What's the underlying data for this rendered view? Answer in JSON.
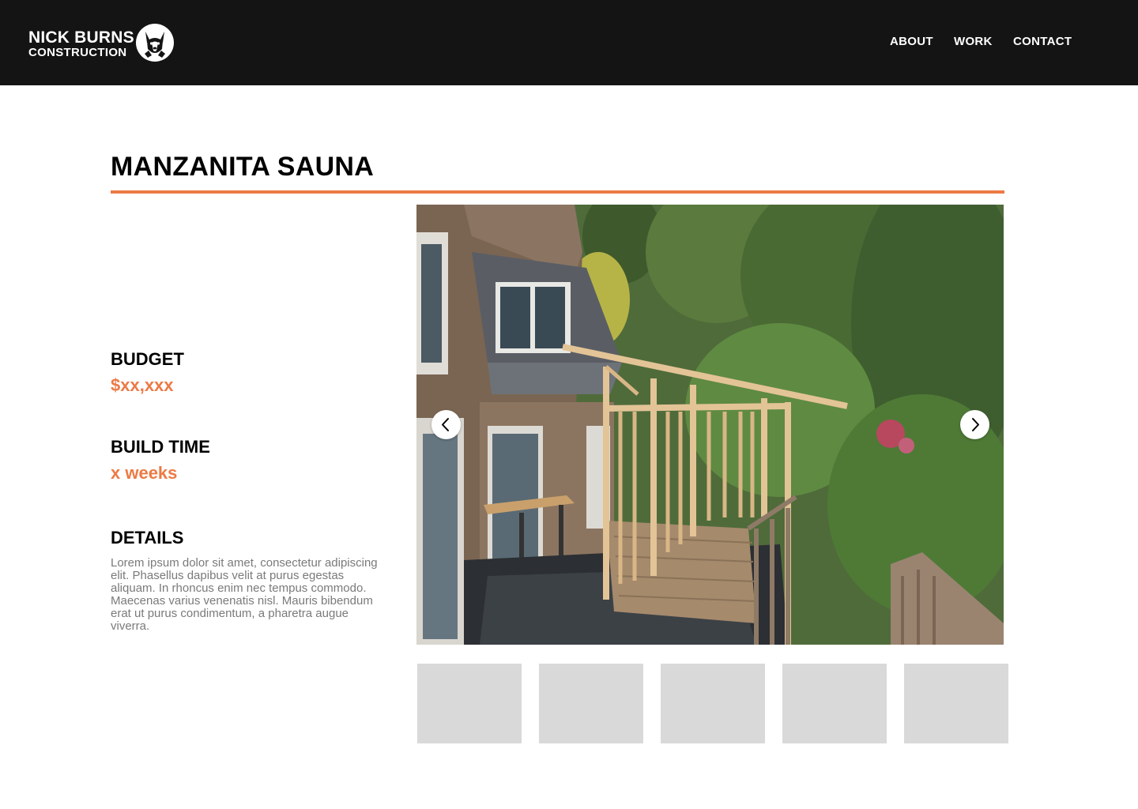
{
  "brand": {
    "line1": "NICK BURNS",
    "line2": "CONSTRUCTION",
    "logo_icon": "husky-dog-icon"
  },
  "nav": {
    "items": [
      {
        "label": "ABOUT"
      },
      {
        "label": "WORK"
      },
      {
        "label": "CONTACT"
      }
    ]
  },
  "project": {
    "title": "MANZANITA SAUNA",
    "budget_label": "BUDGET",
    "budget_value": "$xx,xxx",
    "build_time_label": "BUILD TIME",
    "build_time_value": "x weeks",
    "details_label": "DETAILS",
    "details_text": "Lorem ipsum dolor sit amet, consectetur adipiscing elit. Phasellus dapibus velit at purus egestas aliquam. In rhoncus enim nec tempus commodo. Maecenas varius venenatis nisl. Mauris bibendum erat ut purus condimentum, a pharetra augue viverra."
  },
  "gallery": {
    "prev_icon": "chevron-left-icon",
    "next_icon": "chevron-right-icon",
    "thumbnail_count": 5
  },
  "colors": {
    "header_bg": "#141414",
    "accent": "#ec7a45",
    "thumbnail_placeholder": "#d9d9d9",
    "body_text_muted": "#7a7a7a"
  }
}
